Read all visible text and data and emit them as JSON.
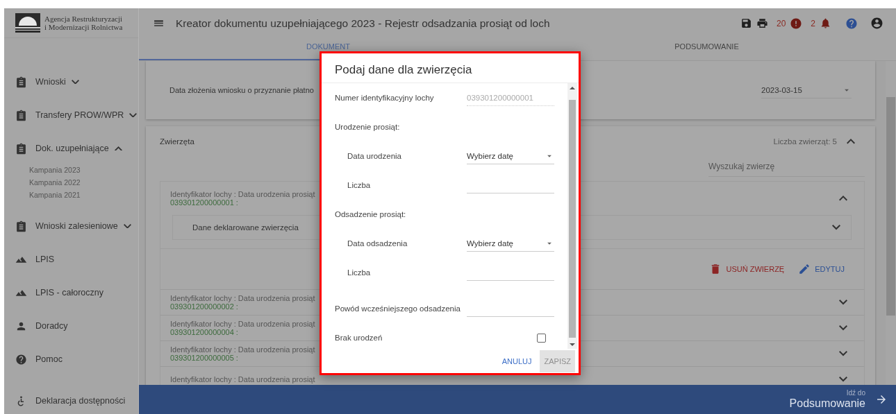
{
  "agency": {
    "line1": "Agencja Restrukturyzacji",
    "line2": "i Modernizacji Rolnictwa"
  },
  "header": {
    "title": "Kreator dokumentu uzupełniającego 2023 - Rejestr odsadzania prosiąt od loch",
    "error_count": "20",
    "notification_count": "2"
  },
  "tabs": [
    {
      "label": "DOKUMENT",
      "selected": true
    },
    {
      "label": "PODSUMOWANIE",
      "selected": false
    }
  ],
  "sidebar": {
    "items": [
      {
        "label": "Wnioski",
        "expanded": false
      },
      {
        "label": "Transfery PROW/WPR",
        "expanded": false
      },
      {
        "label": "Dok. uzupełniające",
        "expanded": true,
        "children": [
          {
            "label": "Kampania 2023"
          },
          {
            "label": "Kampania 2022"
          },
          {
            "label": "Kampania 2021"
          }
        ]
      },
      {
        "label": "Wnioski zalesieniowe",
        "expanded": false
      },
      {
        "label": "LPIS"
      },
      {
        "label": "LPIS - całoroczny"
      },
      {
        "label": "Doradcy"
      },
      {
        "label": "Pomoc"
      },
      {
        "label": "Deklaracja dostępności"
      }
    ]
  },
  "basic_data": {
    "label": "Data złożenia wniosku o przyznanie płatno",
    "value": "2023-03-15"
  },
  "animals": {
    "title": "Zwierzęta",
    "count": "Liczba zwierząt: 5",
    "expanded": true,
    "search": {
      "placeholder": "Wyszukaj zwierzę"
    },
    "rows": [
      {
        "label": "Identyfikator lochy : Data urodzenia prosiąt",
        "id": "039301200000001 :",
        "expanded": true,
        "details": {
          "title": "Dane deklarowane zwierzęcia",
          "expanded": false
        },
        "actions": [
          {
            "label": "USUŃ ZWIERZĘ",
            "kind": "delete"
          },
          {
            "label": "EDYTUJ",
            "kind": "edit"
          }
        ]
      },
      {
        "label": "Identyfikator lochy : Data urodzenia prosiąt",
        "id": "039301200000002 :",
        "expanded": false
      },
      {
        "label": "Identyfikator lochy : Data urodzenia prosiąt",
        "id": "039301200000004 :",
        "expanded": false
      },
      {
        "label": "Identyfikator lochy : Data urodzenia prosiąt",
        "id": "039301200000005 :",
        "expanded": false
      },
      {
        "label": "Identyfikator lochy : Data urodzenia prosiąt",
        "expanded": false
      }
    ]
  },
  "footer": {
    "hint": "Idź do",
    "target": "Podsumowanie"
  },
  "dialog": {
    "title": "Podaj dane dla zwierzęcia",
    "fields": [
      {
        "kind": "text",
        "label": "Numer identyfikacyjny lochy",
        "value": "039301200000001",
        "disabled": true
      },
      {
        "kind": "group",
        "label": "Urodzenie prosiąt:",
        "children": [
          {
            "kind": "date",
            "label": "Data urodzenia",
            "placeholder": "Wybierz datę",
            "disabled": false
          },
          {
            "kind": "text",
            "label": "Liczba",
            "disabled": false
          }
        ]
      },
      {
        "kind": "group",
        "label": "Odsadzenie prosiąt:",
        "children": [
          {
            "kind": "date",
            "label": "Data odsadzenia",
            "placeholder": "Wybierz datę",
            "disabled": false
          },
          {
            "kind": "text",
            "label": "Liczba",
            "disabled": false
          }
        ]
      },
      {
        "kind": "text",
        "label": "Powód wcześniejszego odsadzenia",
        "disabled": false
      },
      {
        "kind": "checkbox",
        "label": "Brak urodzeń",
        "checked": false
      }
    ],
    "buttons": [
      {
        "label": "ANULUJ",
        "disabled": false
      },
      {
        "label": "ZAPISZ",
        "disabled": true
      }
    ]
  }
}
